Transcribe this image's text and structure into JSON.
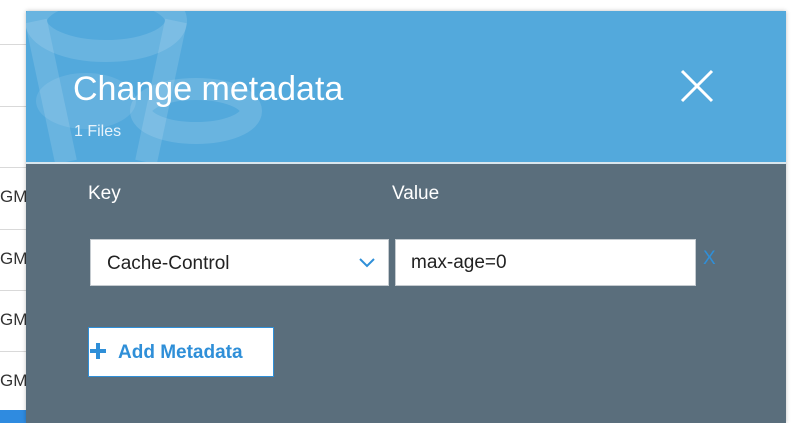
{
  "modal": {
    "title": "Change metadata",
    "subtitle": "1 Files"
  },
  "columns": {
    "key_label": "Key",
    "value_label": "Value"
  },
  "row": {
    "key_selected": "Cache-Control",
    "value": "max-age=0",
    "remove_label": "X"
  },
  "actions": {
    "add_label": "Add Metadata"
  },
  "background": {
    "cells": [
      "GM",
      "GM",
      "GM",
      "GM"
    ]
  },
  "colors": {
    "header": "#53a9dc",
    "body": "#5a6e7c",
    "accent": "#2f8fd8"
  }
}
